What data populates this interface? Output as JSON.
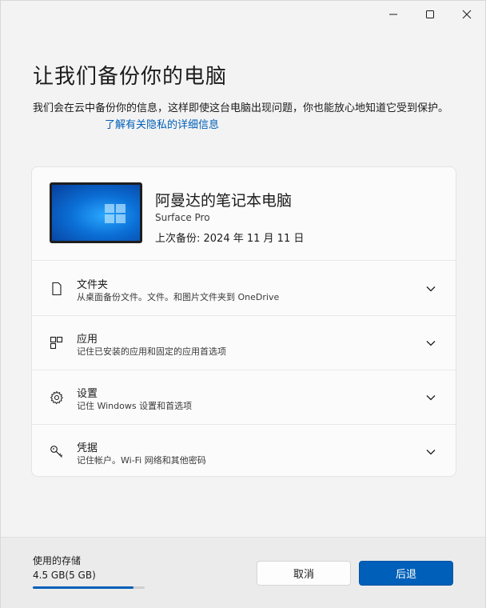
{
  "window": {
    "controls": [
      "minimize-icon",
      "maximize-icon",
      "close-icon"
    ]
  },
  "page": {
    "title": "让我们备份你的电脑",
    "description": "我们会在云中备份你的信息，这样即使这台电脑出现问题，你也能放心地知道它受到保护。",
    "privacy_link": "了解有关隐私的详细信息"
  },
  "device": {
    "name": "阿曼达的笔记本电脑",
    "model": "Surface Pro",
    "last_backup": "上次备份: 2024 年 11 月 11 日"
  },
  "rows": [
    {
      "icon": "file-icon",
      "title": "文件夹",
      "subtitle": "从桌面备份文件。文件。和图片文件夹到 OneDrive"
    },
    {
      "icon": "apps-icon",
      "title": "应用",
      "subtitle": "记住已安装的应用和固定的应用首选项"
    },
    {
      "icon": "gear-icon",
      "title": "设置",
      "subtitle": "记住 Windows 设置和首选项"
    },
    {
      "icon": "key-icon",
      "title": "凭据",
      "subtitle": "记住帐户。Wi-Fi 网络和其他密码"
    }
  ],
  "storage": {
    "label": "使用的存储",
    "value": "4.5 GB(5 GB)",
    "used_fraction": 0.9
  },
  "buttons": {
    "cancel": "取消",
    "back": "后退"
  },
  "colors": {
    "accent": "#005fb8",
    "background": "#f3f3f3"
  }
}
